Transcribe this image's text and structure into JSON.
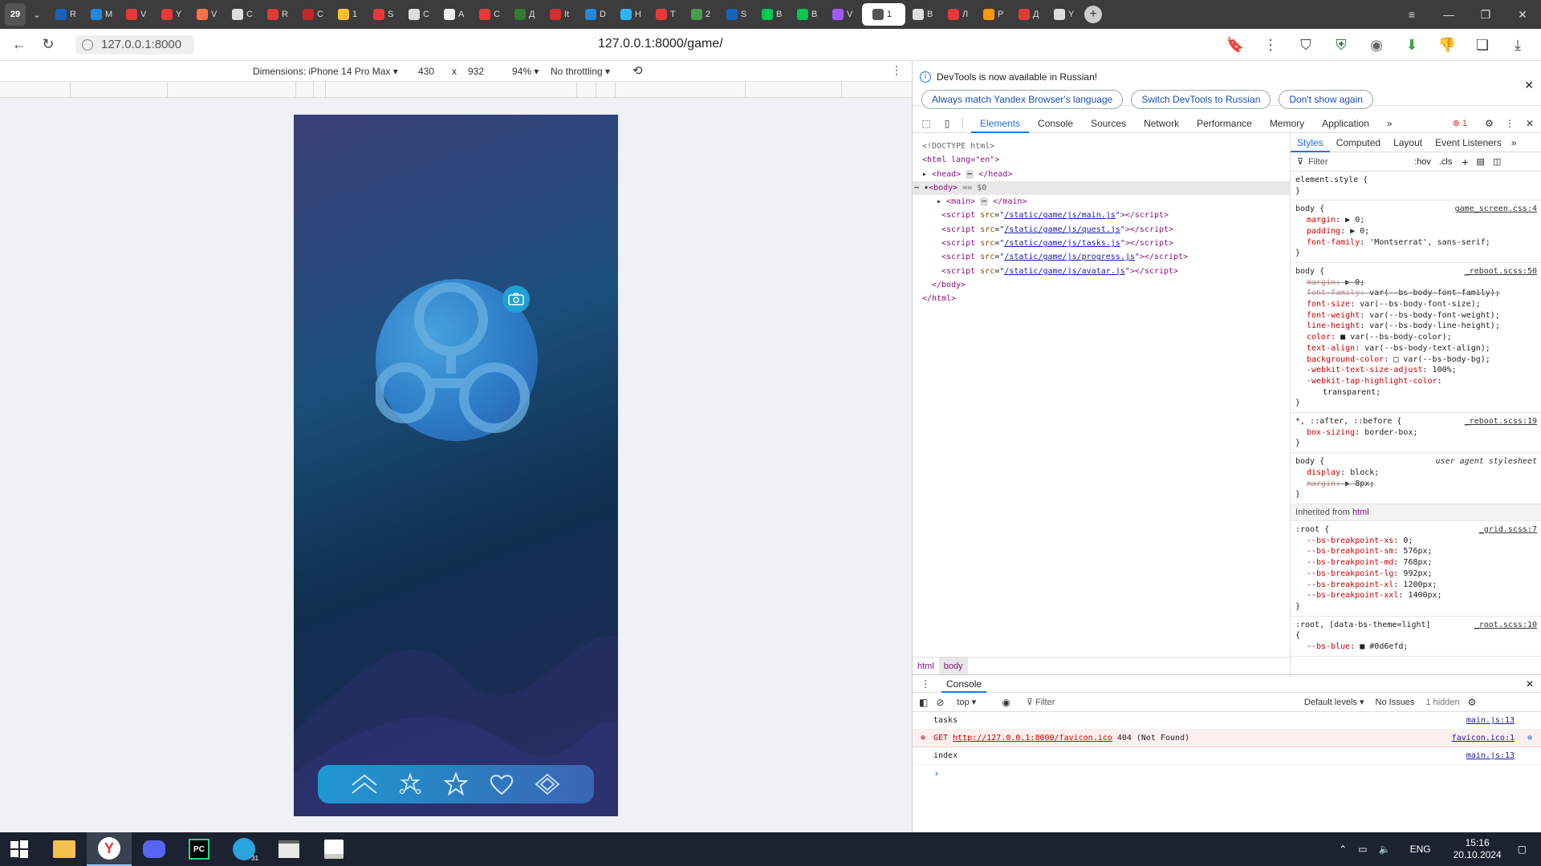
{
  "tabstrip": {
    "tab_count": "29",
    "tabs": [
      {
        "icon": "bar-icon",
        "label": "R",
        "color": "#1565c0"
      },
      {
        "icon": "chat-icon",
        "label": "M",
        "color": "#1e88e5"
      },
      {
        "icon": "youtube-icon",
        "label": "V",
        "color": "#e53935"
      },
      {
        "icon": "youtube-icon",
        "label": "Y",
        "color": "#e53935"
      },
      {
        "icon": "bolt-icon",
        "label": "V",
        "color": "#ff7043"
      },
      {
        "icon": "openai-icon",
        "label": "C",
        "color": "#ddd"
      },
      {
        "icon": "letter-a-icon",
        "label": "R",
        "color": "#e53935"
      },
      {
        "icon": "aw-icon",
        "label": "C",
        "color": "#c62828"
      },
      {
        "icon": "mail-icon",
        "label": "1",
        "color": "#fbc02d"
      },
      {
        "icon": "pin-icon",
        "label": "S",
        "color": "#e53935"
      },
      {
        "icon": "openai-icon",
        "label": "C",
        "color": "#ddd"
      },
      {
        "icon": "github-icon",
        "label": "A",
        "color": "#eee"
      },
      {
        "icon": "dot-icon",
        "label": "C",
        "color": "#e53935"
      },
      {
        "icon": "sheet-icon",
        "label": "Д",
        "color": "#2e7d32"
      },
      {
        "icon": "d-icon",
        "label": "It",
        "color": "#d32f2f"
      },
      {
        "icon": "sb-icon",
        "label": "D",
        "color": "#1e88e5"
      },
      {
        "icon": "cloud-icon",
        "label": "H",
        "color": "#29b6f6"
      },
      {
        "icon": "ya-icon",
        "label": "T",
        "color": "#e53935"
      },
      {
        "icon": "plus-sheet-icon",
        "label": "2",
        "color": "#43a047"
      },
      {
        "icon": "steam-icon",
        "label": "S",
        "color": "#1565c0"
      },
      {
        "icon": "arrow-icon",
        "label": "B",
        "color": "#00c853"
      },
      {
        "icon": "arrow-icon",
        "label": "B",
        "color": "#00c853"
      },
      {
        "icon": "figma-icon",
        "label": "V",
        "color": "#a259ff"
      },
      {
        "icon": "page-icon",
        "label": "1",
        "color": "#555",
        "active": true
      },
      {
        "icon": "page-icon",
        "label": "B",
        "color": "#ddd"
      },
      {
        "icon": "two-icon",
        "label": "Л",
        "color": "#e53935"
      },
      {
        "icon": "flag-icon",
        "label": "P",
        "color": "#ff9800"
      },
      {
        "icon": "flower-icon",
        "label": "Д",
        "color": "#e53935"
      },
      {
        "icon": "openai-icon",
        "label": "Y",
        "color": "#ddd"
      }
    ]
  },
  "address_bar": {
    "origin": "127.0.0.1:8000",
    "url": "127.0.0.1:8000/game/"
  },
  "device_toolbar": {
    "dimensions_label": "Dimensions: iPhone 14 Pro Max",
    "width": "430",
    "times": "x",
    "height": "932",
    "zoom": "94%",
    "throttling": "No throttling"
  },
  "devtools": {
    "info_text": "DevTools is now available in Russian!",
    "info_buttons": [
      "Always match Yandex Browser's language",
      "Switch DevTools to Russian",
      "Don't show again"
    ],
    "tabs": [
      "Elements",
      "Console",
      "Sources",
      "Network",
      "Performance",
      "Memory",
      "Application"
    ],
    "error_count": "1",
    "dom": {
      "doctype": "<!DOCTYPE html>",
      "html_open": "<html lang=\"en\">",
      "head": "<head>",
      "head_close": "</head>",
      "body": "<body>",
      "eq_dollar": "== $0",
      "main": "<main>",
      "main_close": "</main>",
      "scripts": [
        "/static/game/js/main.js",
        "/static/game/js/quest.js",
        "/static/game/js/tasks.js",
        "/static/game/js/progress.js",
        "/static/game/js/avatar.js"
      ],
      "body_close": "</body>",
      "html_close": "</html>"
    },
    "breadcrumb": [
      "html",
      "body"
    ],
    "style_tabs": [
      "Styles",
      "Computed",
      "Layout",
      "Event Listeners"
    ],
    "filter_placeholder": "Filter",
    "hov": ":hov",
    "cls": ".cls",
    "rules": {
      "element_style": "element.style {",
      "body1": {
        "selector": "body {",
        "source": "game_screen.css:4",
        "props": [
          [
            "margin",
            "▶ 0;"
          ],
          [
            "padding",
            "▶ 0;"
          ],
          [
            "font-family",
            "'Montserrat', sans-serif;"
          ]
        ]
      },
      "body2": {
        "selector": "body {",
        "source": "_reboot.scss:50",
        "props": [
          [
            "margin",
            "▶ 0;",
            true
          ],
          [
            "font-family",
            "var(--bs-body-font-family);",
            true
          ],
          [
            "font-size",
            "var(--bs-body-font-size);"
          ],
          [
            "font-weight",
            "var(--bs-body-font-weight);"
          ],
          [
            "line-height",
            "var(--bs-body-line-height);"
          ],
          [
            "color",
            "■ var(--bs-body-color);"
          ],
          [
            "text-align",
            "var(--bs-body-text-align);"
          ],
          [
            "background-color",
            "□ var(--bs-body-bg);"
          ],
          [
            "-webkit-text-size-adjust",
            "100%;"
          ],
          [
            "-webkit-tap-highlight-color",
            ""
          ]
        ],
        "extra": "transparent;"
      },
      "universal": {
        "selector": "*, ::after, ::before {",
        "source": "_reboot.scss:19",
        "props": [
          [
            "box-sizing",
            "border-box;"
          ]
        ]
      },
      "ua_body": {
        "selector": "body {",
        "source": "user agent stylesheet",
        "props": [
          [
            "display",
            "block;"
          ],
          [
            "margin",
            "▶ 8px;",
            true
          ]
        ]
      },
      "inherited_label": "Inherited from",
      "inherited_tag": "html",
      "root": {
        "selector": ":root {",
        "source": "_grid.scss:7",
        "props": [
          [
            "--bs-breakpoint-xs",
            "0;"
          ],
          [
            "--bs-breakpoint-sm",
            "576px;"
          ],
          [
            "--bs-breakpoint-md",
            "768px;"
          ],
          [
            "--bs-breakpoint-lg",
            "992px;"
          ],
          [
            "--bs-breakpoint-xl",
            "1200px;"
          ],
          [
            "--bs-breakpoint-xxl",
            "1400px;"
          ]
        ]
      },
      "root2": {
        "selector": ":root, [data-bs-theme=light]",
        "source": "_root.scss:10",
        "open": "{",
        "props": [
          [
            "--bs-blue",
            "■ #0d6efd;"
          ]
        ]
      }
    },
    "console": {
      "tab": "Console",
      "context": "top",
      "filter": "Filter",
      "levels": "Default levels",
      "issues": "No Issues",
      "hidden": "1 hidden",
      "lines": [
        {
          "text": "tasks",
          "source": "main.js:13"
        },
        {
          "get": "GET",
          "link": "http://127.0.0.1:8000/favicon.ico",
          "status": "404 (Not Found)",
          "source": "favicon.ico:1"
        },
        {
          "text": "index",
          "source": "main.js:13"
        }
      ],
      "prompt": "›"
    }
  },
  "game": {
    "nav_icons": [
      "double-chevron-icon",
      "stars-icon",
      "star-icon",
      "heart-icon",
      "diamond-icon"
    ],
    "camera_icon": "camera-add-icon"
  },
  "taskbar": {
    "apps": [
      "windows-icon",
      "explorer-icon",
      "yandex-icon",
      "discord-icon",
      "pycharm-icon",
      "telegram-icon",
      "window-icon",
      "list-icon"
    ],
    "lang": "ENG",
    "time": "15:16",
    "date": "20.10.2024",
    "telegram_badge": "31"
  }
}
